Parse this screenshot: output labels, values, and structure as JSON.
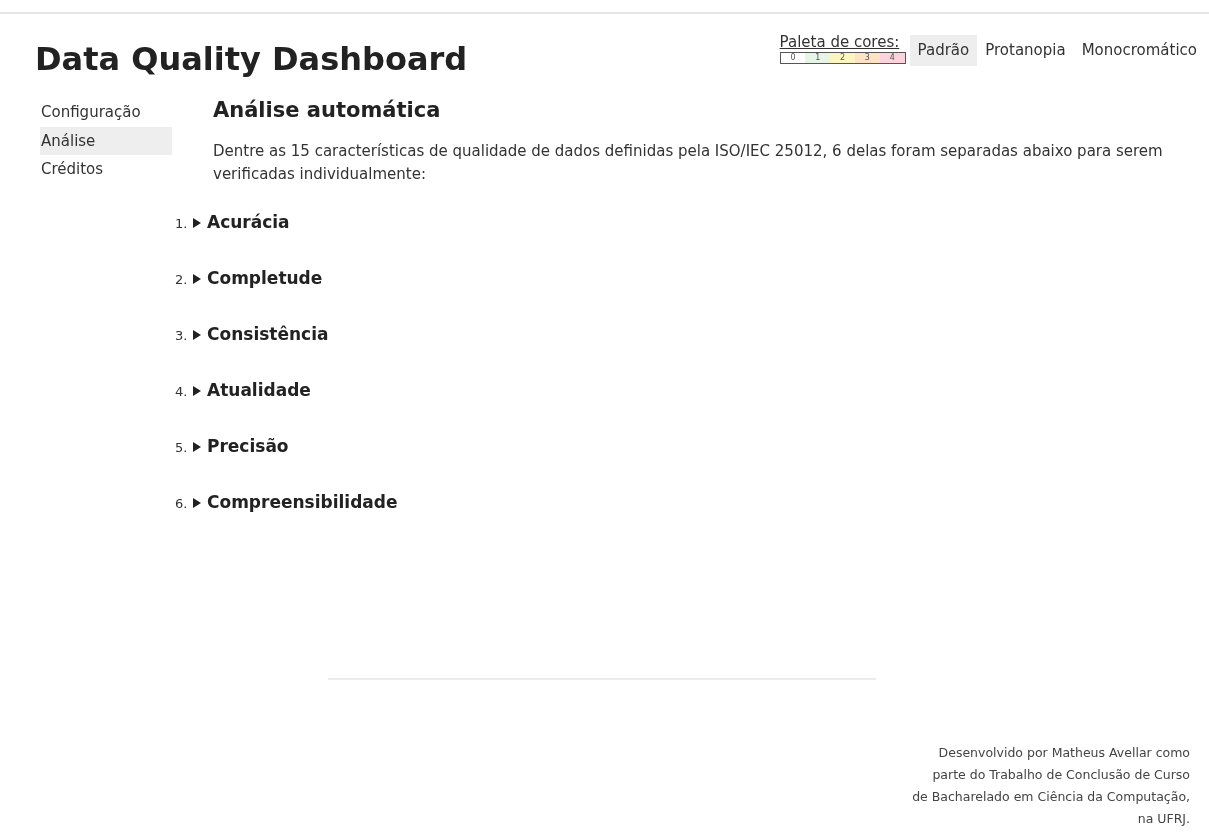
{
  "title": "Data Quality Dashboard",
  "palette": {
    "label": "Paleta de cores:",
    "legend": [
      {
        "text": "0",
        "color": "#ffffff"
      },
      {
        "text": "1",
        "color": "#e6f5e6"
      },
      {
        "text": "2",
        "color": "#fbf5c0"
      },
      {
        "text": "3",
        "color": "#fde2c4"
      },
      {
        "text": "4",
        "color": "#fbd3dc"
      }
    ],
    "options": [
      {
        "label": "Padrão",
        "selected": true
      },
      {
        "label": "Protanopia",
        "selected": false
      },
      {
        "label": "Monocromático",
        "selected": false
      }
    ]
  },
  "sidebar": {
    "items": [
      {
        "label": "Configuração",
        "selected": false
      },
      {
        "label": "Análise",
        "selected": true
      },
      {
        "label": "Créditos",
        "selected": false
      }
    ]
  },
  "heading": "Análise automática",
  "intro": "Dentre as 15 características de qualidade de dados definidas pela ISO/IEC 25012, 6 delas foram separadas abaixo para serem verificadas individualmente:",
  "sections": [
    {
      "number": "1.",
      "title": "Acurácia",
      "expanded": false
    },
    {
      "number": "2.",
      "title": "Completude",
      "expanded": false
    },
    {
      "number": "3.",
      "title": "Consistência",
      "expanded": false
    },
    {
      "number": "4.",
      "title": "Atualidade",
      "expanded": false
    },
    {
      "number": "5.",
      "title": "Precisão",
      "expanded": false
    },
    {
      "number": "6.",
      "title": "Compreensibilidade",
      "expanded": false
    }
  ],
  "footer": {
    "lines": [
      "Desenvolvido por Matheus Avellar como",
      "parte do Trabalho de Conclusão de Curso",
      "de Bacharelado em Ciência da Computação,",
      "na UFRJ."
    ]
  }
}
